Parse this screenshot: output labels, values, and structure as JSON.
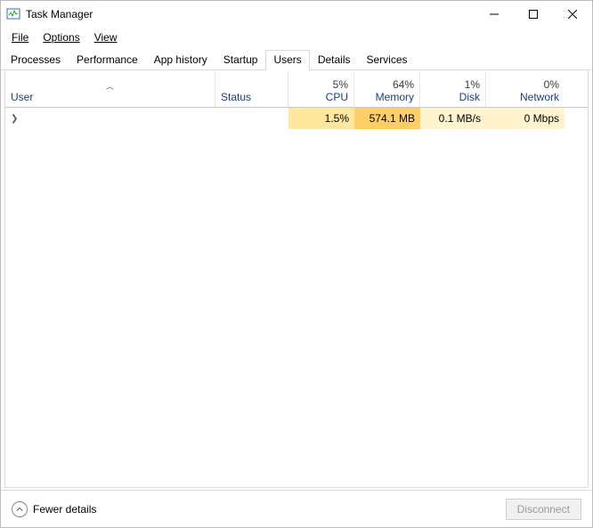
{
  "title": "Task Manager",
  "menu": {
    "file": "File",
    "options": "Options",
    "view": "View"
  },
  "tabs": {
    "processes": "Processes",
    "performance": "Performance",
    "app_history": "App history",
    "startup": "Startup",
    "users": "Users",
    "details": "Details",
    "services": "Services"
  },
  "headers": {
    "user": "User",
    "status": "Status",
    "cpu_label": "CPU",
    "cpu_pct": "5%",
    "memory_label": "Memory",
    "memory_pct": "64%",
    "disk_label": "Disk",
    "disk_pct": "1%",
    "network_label": "Network",
    "network_pct": "0%"
  },
  "rows": [
    {
      "user": "",
      "status": "",
      "cpu": "1.5%",
      "memory": "574.1 MB",
      "disk": "0.1 MB/s",
      "network": "0 Mbps"
    }
  ],
  "footer": {
    "fewer_details": "Fewer details",
    "disconnect": "Disconnect"
  }
}
